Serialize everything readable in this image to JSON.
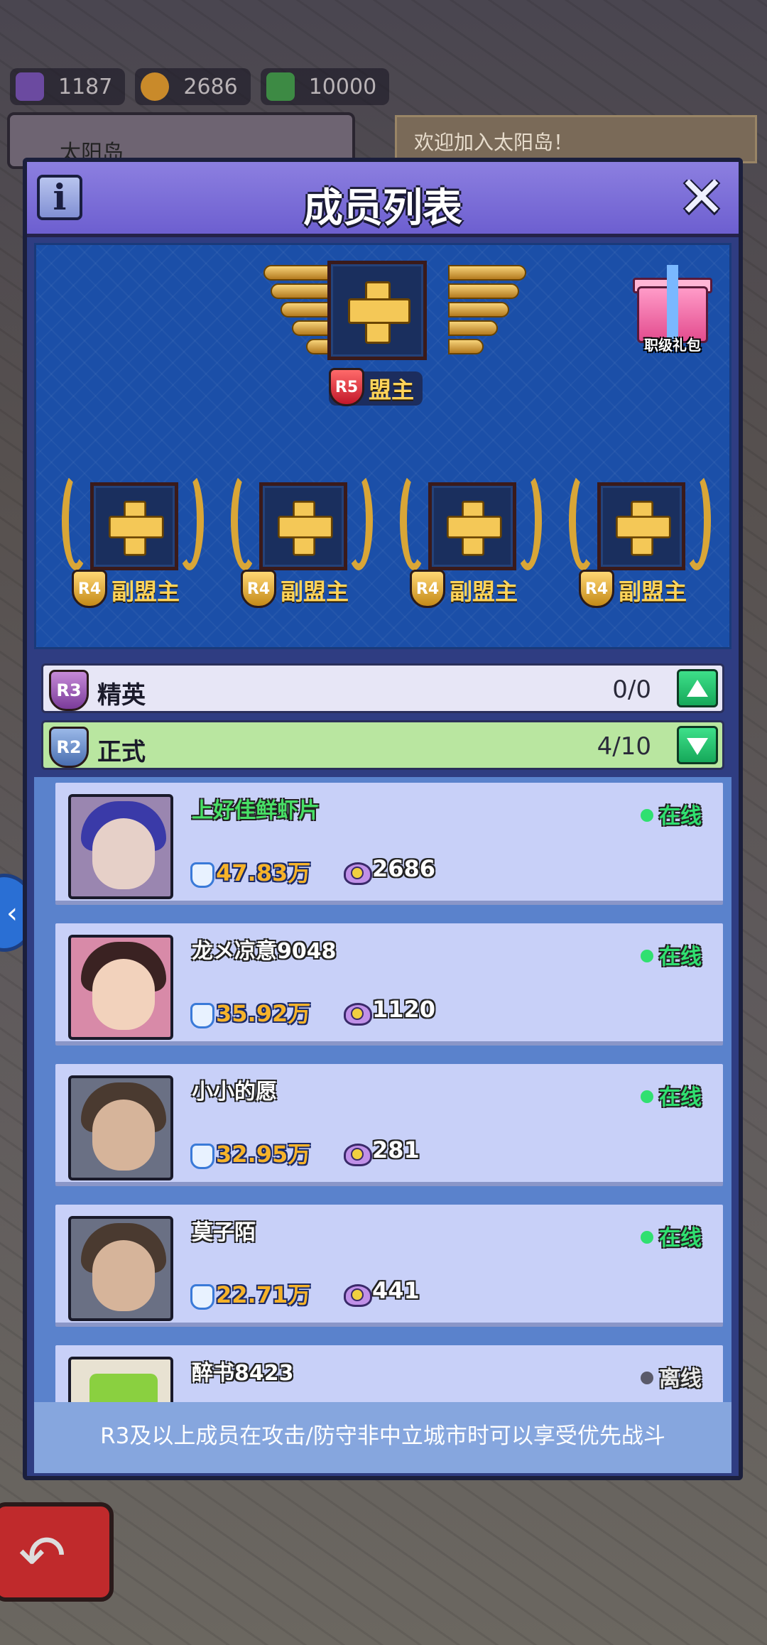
{
  "background": {
    "resources": [
      {
        "name": "resource-1",
        "value": "1187",
        "icon": "scroll-icon"
      },
      {
        "name": "resource-2",
        "value": "2686",
        "icon": "medal-icon"
      },
      {
        "name": "resource-3",
        "value": "10000",
        "icon": "book-icon"
      }
    ],
    "alliance_name": "太阳岛",
    "welcome_text": "欢迎加入太阳岛！"
  },
  "dialog": {
    "title": "成员列表",
    "info_icon": "info-icon",
    "close_icon": "close-icon",
    "leader": {
      "rank": "R5",
      "label": "盟主"
    },
    "vice_leaders": [
      {
        "rank": "R4",
        "label": "副盟主"
      },
      {
        "rank": "R4",
        "label": "副盟主"
      },
      {
        "rank": "R4",
        "label": "副盟主"
      },
      {
        "rank": "R4",
        "label": "副盟主"
      }
    ],
    "gift": {
      "label": "职级礼包",
      "icon": "gift-icon"
    },
    "ranks": [
      {
        "rank": "R3",
        "name": "精英",
        "count": "0/0",
        "toggle_icon": "arrow-up-icon"
      },
      {
        "rank": "R2",
        "name": "正式",
        "count": "4/10",
        "toggle_icon": "arrow-down-icon"
      }
    ],
    "members": [
      {
        "name": "上好佳鲜虾片",
        "status": "在线",
        "online": true,
        "power": "47.83万",
        "badge": "2686",
        "highlight": true
      },
      {
        "name": "龙メ凉意9048",
        "status": "在线",
        "online": true,
        "power": "35.92万",
        "badge": "1120",
        "highlight": false
      },
      {
        "name": "小小的愿",
        "status": "在线",
        "online": true,
        "power": "32.95万",
        "badge": "281",
        "highlight": false
      },
      {
        "name": "莫子陌",
        "status": "在线",
        "online": true,
        "power": "22.71万",
        "badge": "441",
        "highlight": false
      },
      {
        "name": "醉书8423",
        "status": "离线",
        "online": false,
        "power": "",
        "badge": "",
        "highlight": false
      }
    ],
    "footer_text": "R3及以上成员在攻击/防守非中立城市时可以享受优先战斗"
  },
  "colors": {
    "header": "#6d5fd0",
    "panel": "#1b4fa8",
    "online": "#30e070",
    "power": "#f6b32a",
    "r2_row": "#b9e6a0"
  }
}
